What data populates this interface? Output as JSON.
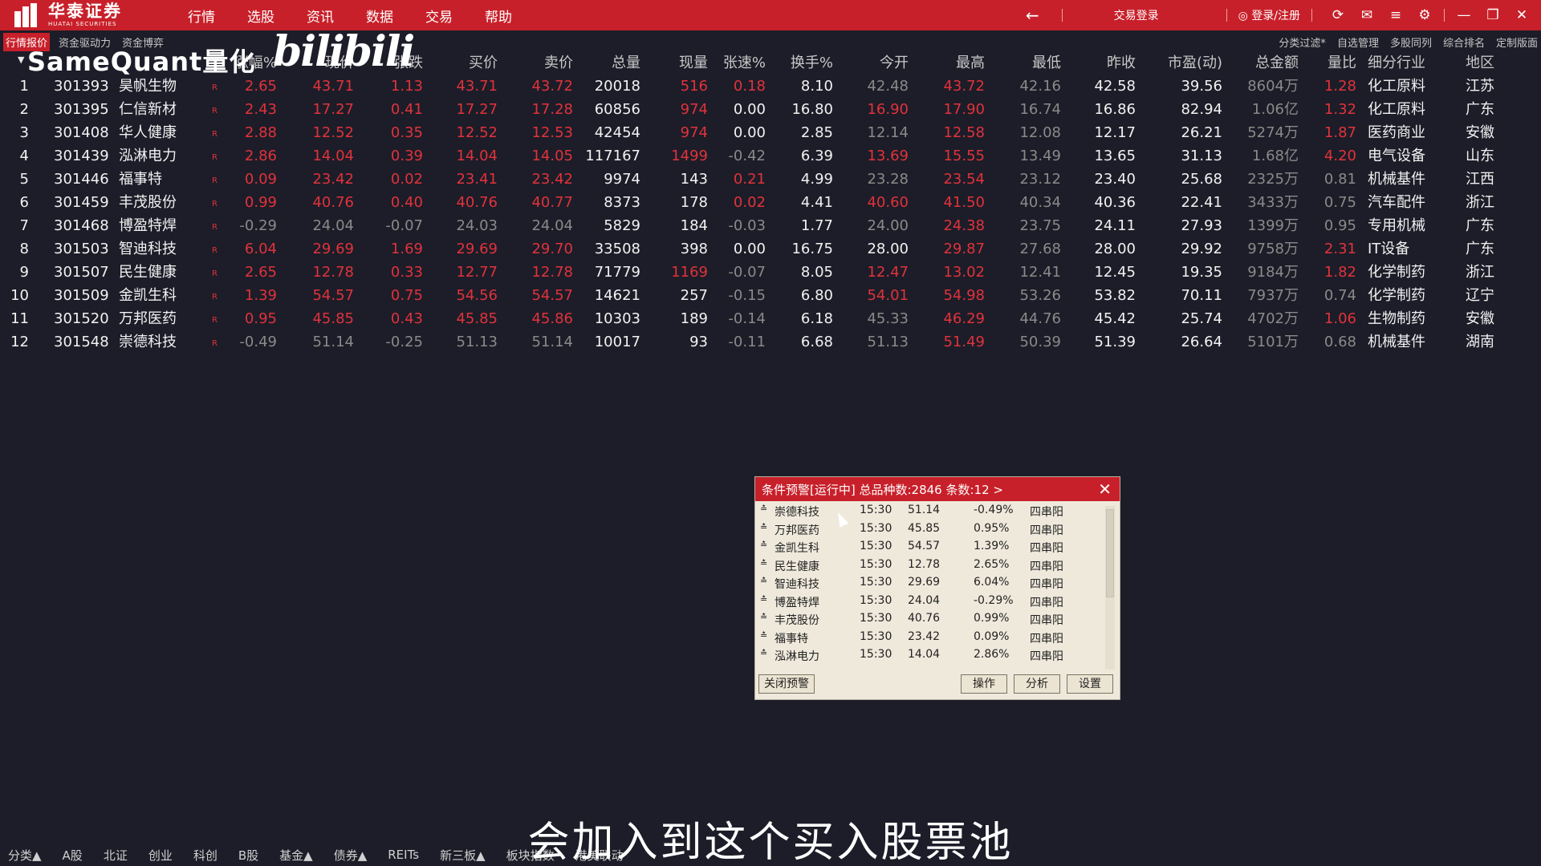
{
  "app": {
    "brand_cn": "华泰证券",
    "brand_en": "HUATAI SECURITIES",
    "menu": [
      "行情",
      "选股",
      "资讯",
      "数据",
      "交易",
      "帮助"
    ],
    "trade_login": "交易登录",
    "user_login": "登录/注册"
  },
  "subtabs": {
    "left": [
      "行情报价",
      "资金驱动力",
      "资金博弈"
    ],
    "right": [
      "分类过滤*",
      "自选管理",
      "多股同列",
      "综合排名",
      "定制版面"
    ]
  },
  "watermark": {
    "text": "SameQuant量化",
    "bili": "bilibili"
  },
  "table": {
    "headers": [
      "涨幅%",
      "现价",
      "张跌",
      "买价",
      "卖价",
      "总量",
      "现量",
      "张速%",
      "换手%",
      "今开",
      "最高",
      "最低",
      "昨收",
      "市盈(动)",
      "总金额",
      "量比",
      "细分行业",
      "地区"
    ],
    "rows": [
      {
        "idx": "1",
        "code": "301393",
        "name": "昊帆生物",
        "chg_pct": "2.65",
        "price": "43.71",
        "chg": "1.13",
        "bid": "43.71",
        "ask": "43.72",
        "vol": "20018",
        "cur_vol": "516",
        "speed": "0.18",
        "turnover": "8.10",
        "open": "42.48",
        "high": "43.72",
        "low": "42.16",
        "prev_close": "42.58",
        "pe": "39.56",
        "amount": "8604万",
        "vol_ratio": "1.28",
        "industry": "化工原料",
        "region": "江苏"
      },
      {
        "idx": "2",
        "code": "301395",
        "name": "仁信新材",
        "chg_pct": "2.43",
        "price": "17.27",
        "chg": "0.41",
        "bid": "17.27",
        "ask": "17.28",
        "vol": "60856",
        "cur_vol": "974",
        "speed": "0.00",
        "turnover": "16.80",
        "open": "16.90",
        "high": "17.90",
        "low": "16.74",
        "prev_close": "16.86",
        "pe": "82.94",
        "amount": "1.06亿",
        "vol_ratio": "1.32",
        "industry": "化工原料",
        "region": "广东"
      },
      {
        "idx": "3",
        "code": "301408",
        "name": "华人健康",
        "chg_pct": "2.88",
        "price": "12.52",
        "chg": "0.35",
        "bid": "12.52",
        "ask": "12.53",
        "vol": "42454",
        "cur_vol": "974",
        "speed": "0.00",
        "turnover": "2.85",
        "open": "12.14",
        "high": "12.58",
        "low": "12.08",
        "prev_close": "12.17",
        "pe": "26.21",
        "amount": "5274万",
        "vol_ratio": "1.87",
        "industry": "医药商业",
        "region": "安徽"
      },
      {
        "idx": "4",
        "code": "301439",
        "name": "泓淋电力",
        "chg_pct": "2.86",
        "price": "14.04",
        "chg": "0.39",
        "bid": "14.04",
        "ask": "14.05",
        "vol": "117167",
        "cur_vol": "1499",
        "speed": "-0.42",
        "turnover": "6.39",
        "open": "13.69",
        "high": "15.55",
        "low": "13.49",
        "prev_close": "13.65",
        "pe": "31.13",
        "amount": "1.68亿",
        "vol_ratio": "4.20",
        "industry": "电气设备",
        "region": "山东"
      },
      {
        "idx": "5",
        "code": "301446",
        "name": "福事特",
        "chg_pct": "0.09",
        "price": "23.42",
        "chg": "0.02",
        "bid": "23.41",
        "ask": "23.42",
        "vol": "9974",
        "cur_vol": "143",
        "speed": "0.21",
        "turnover": "4.99",
        "open": "23.28",
        "high": "23.54",
        "low": "23.12",
        "prev_close": "23.40",
        "pe": "25.68",
        "amount": "2325万",
        "vol_ratio": "0.81",
        "industry": "机械基件",
        "region": "江西"
      },
      {
        "idx": "6",
        "code": "301459",
        "name": "丰茂股份",
        "chg_pct": "0.99",
        "price": "40.76",
        "chg": "0.40",
        "bid": "40.76",
        "ask": "40.77",
        "vol": "8373",
        "cur_vol": "178",
        "speed": "0.02",
        "turnover": "4.41",
        "open": "40.60",
        "high": "41.50",
        "low": "40.34",
        "prev_close": "40.36",
        "pe": "22.41",
        "amount": "3433万",
        "vol_ratio": "0.75",
        "industry": "汽车配件",
        "region": "浙江"
      },
      {
        "idx": "7",
        "code": "301468",
        "name": "博盈特焊",
        "chg_pct": "-0.29",
        "price": "24.04",
        "chg": "-0.07",
        "bid": "24.03",
        "ask": "24.04",
        "vol": "5829",
        "cur_vol": "184",
        "speed": "-0.03",
        "turnover": "1.77",
        "open": "24.00",
        "high": "24.38",
        "low": "23.75",
        "prev_close": "24.11",
        "pe": "27.93",
        "amount": "1399万",
        "vol_ratio": "0.95",
        "industry": "专用机械",
        "region": "广东"
      },
      {
        "idx": "8",
        "code": "301503",
        "name": "智迪科技",
        "chg_pct": "6.04",
        "price": "29.69",
        "chg": "1.69",
        "bid": "29.69",
        "ask": "29.70",
        "vol": "33508",
        "cur_vol": "398",
        "speed": "0.00",
        "turnover": "16.75",
        "open": "28.00",
        "high": "29.87",
        "low": "27.68",
        "prev_close": "28.00",
        "pe": "29.92",
        "amount": "9758万",
        "vol_ratio": "2.31",
        "industry": "IT设备",
        "region": "广东"
      },
      {
        "idx": "9",
        "code": "301507",
        "name": "民生健康",
        "chg_pct": "2.65",
        "price": "12.78",
        "chg": "0.33",
        "bid": "12.77",
        "ask": "12.78",
        "vol": "71779",
        "cur_vol": "1169",
        "speed": "-0.07",
        "turnover": "8.05",
        "open": "12.47",
        "high": "13.02",
        "low": "12.41",
        "prev_close": "12.45",
        "pe": "19.35",
        "amount": "9184万",
        "vol_ratio": "1.82",
        "industry": "化学制药",
        "region": "浙江"
      },
      {
        "idx": "10",
        "code": "301509",
        "name": "金凯生科",
        "chg_pct": "1.39",
        "price": "54.57",
        "chg": "0.75",
        "bid": "54.56",
        "ask": "54.57",
        "vol": "14621",
        "cur_vol": "257",
        "speed": "-0.15",
        "turnover": "6.80",
        "open": "54.01",
        "high": "54.98",
        "low": "53.26",
        "prev_close": "53.82",
        "pe": "70.11",
        "amount": "7937万",
        "vol_ratio": "0.74",
        "industry": "化学制药",
        "region": "辽宁"
      },
      {
        "idx": "11",
        "code": "301520",
        "name": "万邦医药",
        "chg_pct": "0.95",
        "price": "45.85",
        "chg": "0.43",
        "bid": "45.85",
        "ask": "45.86",
        "vol": "10303",
        "cur_vol": "189",
        "speed": "-0.14",
        "turnover": "6.18",
        "open": "45.33",
        "high": "46.29",
        "low": "44.76",
        "prev_close": "45.42",
        "pe": "25.74",
        "amount": "4702万",
        "vol_ratio": "1.06",
        "industry": "生物制药",
        "region": "安徽"
      },
      {
        "idx": "12",
        "code": "301548",
        "name": "崇德科技",
        "chg_pct": "-0.49",
        "price": "51.14",
        "chg": "-0.25",
        "bid": "51.13",
        "ask": "51.14",
        "vol": "10017",
        "cur_vol": "93",
        "speed": "-0.11",
        "turnover": "6.68",
        "open": "51.13",
        "high": "51.49",
        "low": "50.39",
        "prev_close": "51.39",
        "pe": "26.64",
        "amount": "5101万",
        "vol_ratio": "0.68",
        "industry": "机械基件",
        "region": "湖南"
      }
    ]
  },
  "alert": {
    "title": "条件预警[运行中] 总品种数:2846 条数:12  >",
    "rows": [
      {
        "name": "崇德科技",
        "time": "15:30",
        "price": "51.14",
        "pct": "-0.49%",
        "signal": "四串阳"
      },
      {
        "name": "万邦医药",
        "time": "15:30",
        "price": "45.85",
        "pct": "0.95%",
        "signal": "四串阳"
      },
      {
        "name": "金凯生科",
        "time": "15:30",
        "price": "54.57",
        "pct": "1.39%",
        "signal": "四串阳"
      },
      {
        "name": "民生健康",
        "time": "15:30",
        "price": "12.78",
        "pct": "2.65%",
        "signal": "四串阳"
      },
      {
        "name": "智迪科技",
        "time": "15:30",
        "price": "29.69",
        "pct": "6.04%",
        "signal": "四串阳"
      },
      {
        "name": "博盈特焊",
        "time": "15:30",
        "price": "24.04",
        "pct": "-0.29%",
        "signal": "四串阳"
      },
      {
        "name": "丰茂股份",
        "time": "15:30",
        "price": "40.76",
        "pct": "0.99%",
        "signal": "四串阳"
      },
      {
        "name": "福事特",
        "time": "15:30",
        "price": "23.42",
        "pct": "0.09%",
        "signal": "四串阳"
      },
      {
        "name": "泓淋电力",
        "time": "15:30",
        "price": "14.04",
        "pct": "2.86%",
        "signal": "四串阳"
      }
    ],
    "buttons": {
      "close": "关闭预警",
      "operate": "操作",
      "analyze": "分析",
      "settings": "设置"
    }
  },
  "bottom_tabs": [
    "分类▲",
    "A股",
    "北证",
    "创业",
    "科创",
    "B股",
    "基金▲",
    "债券▲",
    "REITs",
    "新三板▲",
    "板块指数",
    "港美联动"
  ],
  "subtitle": "会加入到这个买入股票池",
  "colors": {
    "up": "#e0323c",
    "flat": "#f2f2f2",
    "down": "#8a8a8a",
    "brand": "#c8202a"
  }
}
